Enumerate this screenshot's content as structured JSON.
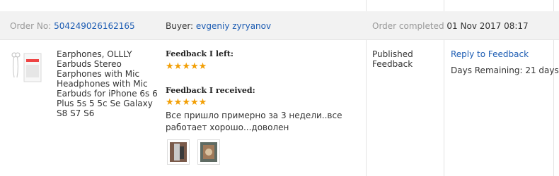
{
  "order": {
    "number_label": "Order No:",
    "number": "504249026162165",
    "buyer_label": "Buyer:",
    "buyer": "evgeniy zyryanov",
    "completed_label": "Order completed",
    "completed_date": "01 Nov 2017 08:17"
  },
  "product": {
    "title": "Earphones, OLLLY Earbuds Stereo Earphones with Mic Headphones with Mic Earbuds for iPhone 6s 6 Plus 5s 5 5c Se Galaxy S8 S7 S6"
  },
  "feedback": {
    "left_label": "Feedback I left:",
    "left_stars": 5,
    "received_label": "Feedback I received:",
    "received_stars": 5,
    "received_comment": "Все пришло примерно за 3 недели..все работает хорошо...доволен"
  },
  "status": {
    "text": "Published Feedback"
  },
  "actions": {
    "reply_label": "Reply to Feedback",
    "days_remaining": "Days Remaining: 21 days"
  },
  "colors": {
    "link": "#1c5cb3",
    "star": "#f29f05",
    "header_bg": "#f2f2f2"
  }
}
